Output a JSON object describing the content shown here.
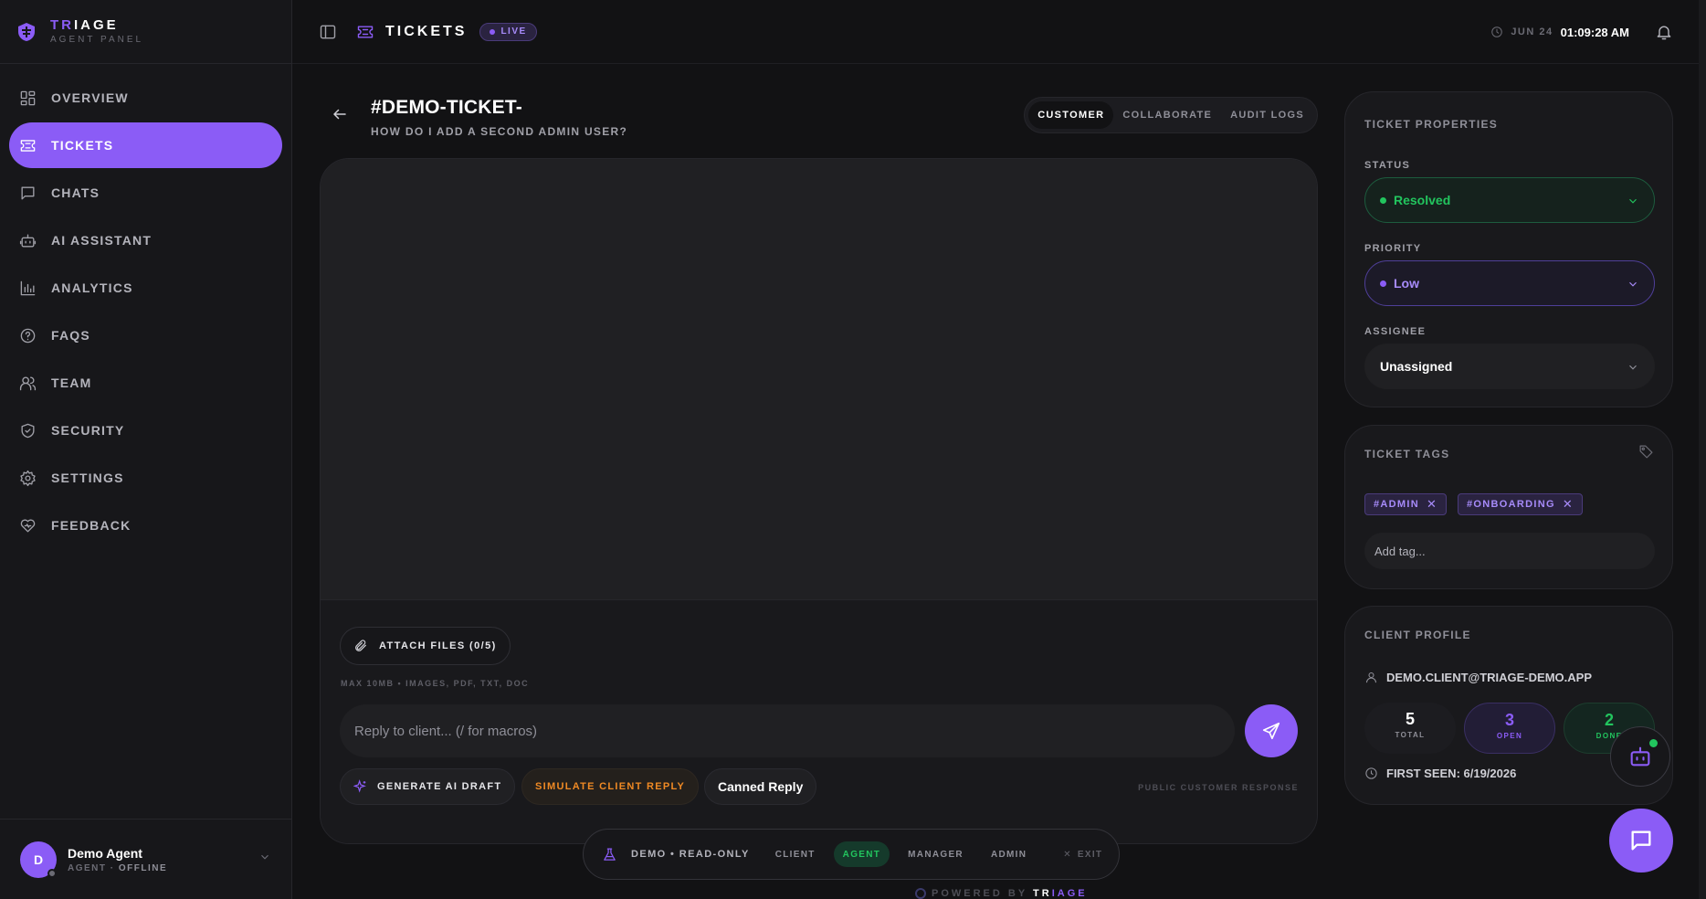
{
  "brand": {
    "name_accent": "TR",
    "name_rest": "IAGE",
    "subtitle": "AGENT PANEL"
  },
  "sidebar": {
    "items": [
      {
        "label": "OVERVIEW",
        "icon": "grid-icon",
        "active": false
      },
      {
        "label": "TICKETS",
        "icon": "ticket-icon",
        "active": true
      },
      {
        "label": "CHATS",
        "icon": "chat-bubble-icon",
        "active": false
      },
      {
        "label": "AI ASSISTANT",
        "icon": "robot-icon",
        "active": false
      },
      {
        "label": "ANALYTICS",
        "icon": "bar-chart-icon",
        "active": false
      },
      {
        "label": "FAQS",
        "icon": "help-circle-icon",
        "active": false
      },
      {
        "label": "TEAM",
        "icon": "users-icon",
        "active": false
      },
      {
        "label": "SECURITY",
        "icon": "shield-icon",
        "active": false
      },
      {
        "label": "SETTINGS",
        "icon": "gear-icon",
        "active": false
      },
      {
        "label": "FEEDBACK",
        "icon": "heart-icon",
        "active": false
      }
    ]
  },
  "user": {
    "initial": "D",
    "name": "Demo Agent",
    "role": "AGENT",
    "separator": " · ",
    "status": "OFFLINE"
  },
  "topbar": {
    "title": "TICKETS",
    "live_label": "LIVE",
    "date": "JUN 24",
    "time": "01:09:28 AM"
  },
  "ticket": {
    "id": "#DEMO-TICKET-",
    "subject": "HOW DO I ADD A SECOND ADMIN USER?",
    "tabs": [
      "CUSTOMER",
      "COLLABORATE",
      "AUDIT LOGS"
    ],
    "active_tab": "CUSTOMER"
  },
  "reply": {
    "attach_label": "ATTACH FILES (0/5)",
    "attach_hint": "MAX 10MB • IMAGES, PDF, TXT, DOC",
    "placeholder": "Reply to client... (/ for macros)",
    "generate_label": "GENERATE AI DRAFT",
    "simulate_label": "SIMULATE CLIENT REPLY",
    "canned_label": "Canned Reply",
    "public_label": "PUBLIC CUSTOMER RESPONSE"
  },
  "demo_bar": {
    "label": "DEMO • READ-ONLY",
    "roles": [
      "CLIENT",
      "AGENT",
      "MANAGER",
      "ADMIN"
    ],
    "active_role": "AGENT",
    "exit_label": "EXIT"
  },
  "powered_by": {
    "prefix": "POWERED BY ",
    "accent": "TR",
    "rest": "IAGE"
  },
  "properties": {
    "title": "TICKET PROPERTIES",
    "status_label": "STATUS",
    "status_value": "Resolved",
    "priority_label": "PRIORITY",
    "priority_value": "Low",
    "assignee_label": "ASSIGNEE",
    "assignee_value": "Unassigned"
  },
  "tags": {
    "title": "TICKET TAGS",
    "items": [
      "#ADMIN",
      "#ONBOARDING"
    ],
    "placeholder": "Add tag..."
  },
  "client_profile": {
    "title": "CLIENT PROFILE",
    "email": "DEMO.CLIENT@TRIAGE-DEMO.APP",
    "total": "5",
    "total_label": "TOTAL",
    "open": "3",
    "open_label": "OPEN",
    "done": "2",
    "done_label": "DONE",
    "first_seen": "FIRST SEEN: 6/19/2026"
  },
  "colors": {
    "accent": "#8b5cf6",
    "success": "#22c55e",
    "warning": "#f08a24",
    "background": "#121214"
  }
}
